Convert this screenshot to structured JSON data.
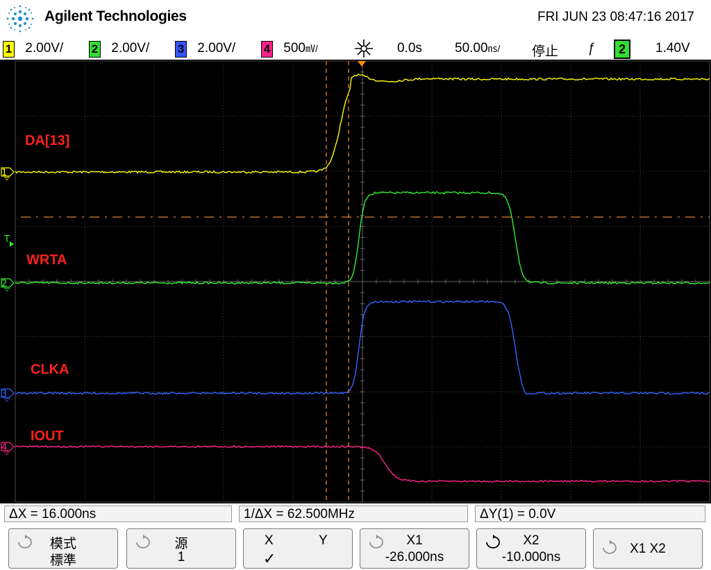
{
  "header": {
    "brand": "Agilent Technologies",
    "datetime": "FRI JUN 23 08:47:16 2017"
  },
  "status": {
    "ch1_num": "1",
    "ch1_scale": "2.00V/",
    "ch2_num": "2",
    "ch2_scale": "2.00V/",
    "ch3_num": "3",
    "ch3_scale": "2.00V/",
    "ch4_num": "4",
    "ch4_scale": "500",
    "ch4_unit": "㎷/",
    "delay": "0.0s",
    "timebase": "50.00",
    "timebase_unit": "㎱/",
    "run_state": "停止",
    "trigger_edge": "ƒ",
    "trigger_source": "2",
    "trigger_level": "1.40V"
  },
  "channels": [
    {
      "id": "1",
      "label": "DA[13]",
      "color": "#ffff00"
    },
    {
      "id": "2",
      "label": "WRTA",
      "color": "#33ee33"
    },
    {
      "id": "3",
      "label": "CLKA",
      "color": "#3366ff"
    },
    {
      "id": "4",
      "label": "IOUT",
      "color": "#ff2288"
    }
  ],
  "markers": {
    "ch1": "1",
    "ch2": "2",
    "ch3": "3",
    "ch4": "4",
    "trigger": "T"
  },
  "measurements": {
    "dx": "ΔX = 16.000ns",
    "inv_dx": "1/ΔX = 62.500MHz",
    "dy": "ΔY(1) = 0.0V"
  },
  "softkeys": {
    "mode_title": "模式",
    "mode_value": "標準",
    "source_title": "源",
    "source_value": "1",
    "x_label": "X",
    "y_label": "Y",
    "x_checked": "✓",
    "x1_title": "X1",
    "x1_value": "-26.000ns",
    "x2_title": "X2",
    "x2_value": "-10.000ns",
    "x1x2_label": "X1 X2"
  }
}
